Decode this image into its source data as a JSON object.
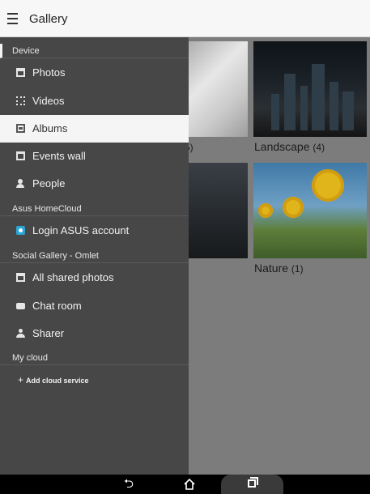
{
  "app": {
    "title": "Gallery"
  },
  "gallery": {
    "albums": [
      {
        "partial_count": "5)"
      },
      {
        "name": "Landscape",
        "count": "(4)"
      },
      {
        "name": "Nature",
        "count": "(1)"
      }
    ]
  },
  "drawer": {
    "sections": [
      {
        "header": "Device",
        "items": [
          {
            "label": "Photos",
            "icon": "photos-icon"
          },
          {
            "label": "Videos",
            "icon": "videos-icon"
          },
          {
            "label": "Albums",
            "icon": "albums-icon",
            "selected": true
          },
          {
            "label": "Events wall",
            "icon": "events-wall-icon"
          },
          {
            "label": "People",
            "icon": "people-icon"
          }
        ]
      },
      {
        "header": "Asus HomeCloud",
        "items": [
          {
            "label": "Login ASUS account",
            "icon": "asus-homecloud-icon"
          }
        ]
      },
      {
        "header": "Social Gallery - Omlet",
        "items": [
          {
            "label": "All shared photos",
            "icon": "shared-photos-icon"
          },
          {
            "label": "Chat room",
            "icon": "chat-icon"
          },
          {
            "label": "Sharer",
            "icon": "sharer-icon"
          }
        ]
      },
      {
        "header": "My cloud",
        "items": []
      }
    ],
    "add_cloud_label": "Add cloud service"
  },
  "colors": {
    "drawer_bg": "#474747",
    "selected_bg": "#f5f5f5",
    "homecloud_accent": "#2aa5d5"
  }
}
